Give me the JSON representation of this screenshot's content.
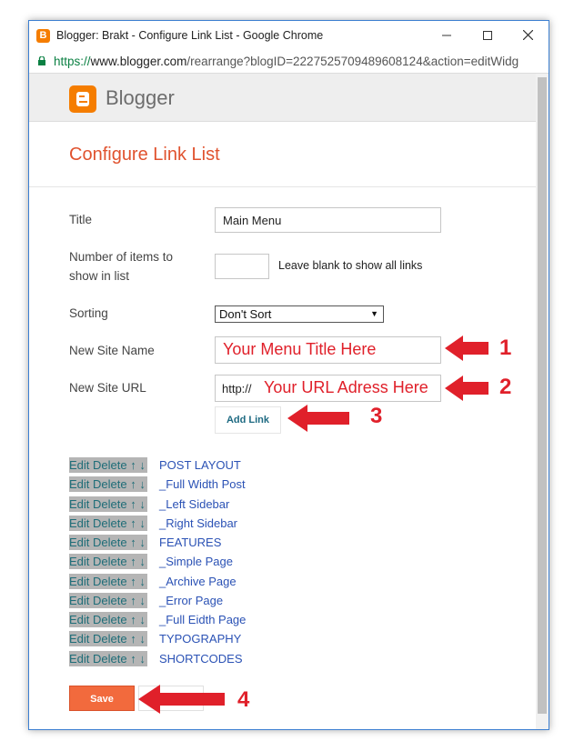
{
  "window": {
    "title": "Blogger: Brakt - Configure Link List - Google Chrome",
    "app_icon_letter": "B",
    "minimize_icon": "minimize-icon",
    "maximize_icon": "maximize-icon",
    "close_icon": "close-icon"
  },
  "address": {
    "protocol": "https://",
    "host": "www.blogger.com",
    "path": "/rearrange?blogID=2227525709489608124&action=editWidg"
  },
  "header": {
    "brand": "Blogger"
  },
  "page": {
    "title": "Configure Link List"
  },
  "form": {
    "title_label": "Title",
    "title_value": "Main Menu",
    "items_label_line1": "Number of items to",
    "items_label_line2": "show in list",
    "items_value": "",
    "items_hint": "Leave blank to show all links",
    "sorting_label": "Sorting",
    "sorting_value": "Don't Sort",
    "site_name_label": "New Site Name",
    "site_url_label": "New Site URL",
    "site_url_prefix": "http://",
    "add_link": "Add Link"
  },
  "annotations": {
    "menu_title": "Your Menu Title Here",
    "url_address": "Your URL Adress Here",
    "n1": "1",
    "n2": "2",
    "n3": "3",
    "n4": "4",
    "color": "#e0202a"
  },
  "links": {
    "controls": "Edit Delete ↑ ↓",
    "items": [
      "POST LAYOUT",
      "_Full Width Post",
      "_Left Sidebar",
      "_Right Sidebar",
      "FEATURES",
      "_Simple Page",
      "_Archive Page",
      "_Error Page",
      "_Full Eidth Page",
      "TYPOGRAPHY",
      "SHORTCODES"
    ]
  },
  "buttons": {
    "save": "Save"
  },
  "colors": {
    "accent": "#f26a3d",
    "title_orange": "#e0522e",
    "link_blue": "#2b52b5",
    "window_border": "#3c7fd1"
  }
}
